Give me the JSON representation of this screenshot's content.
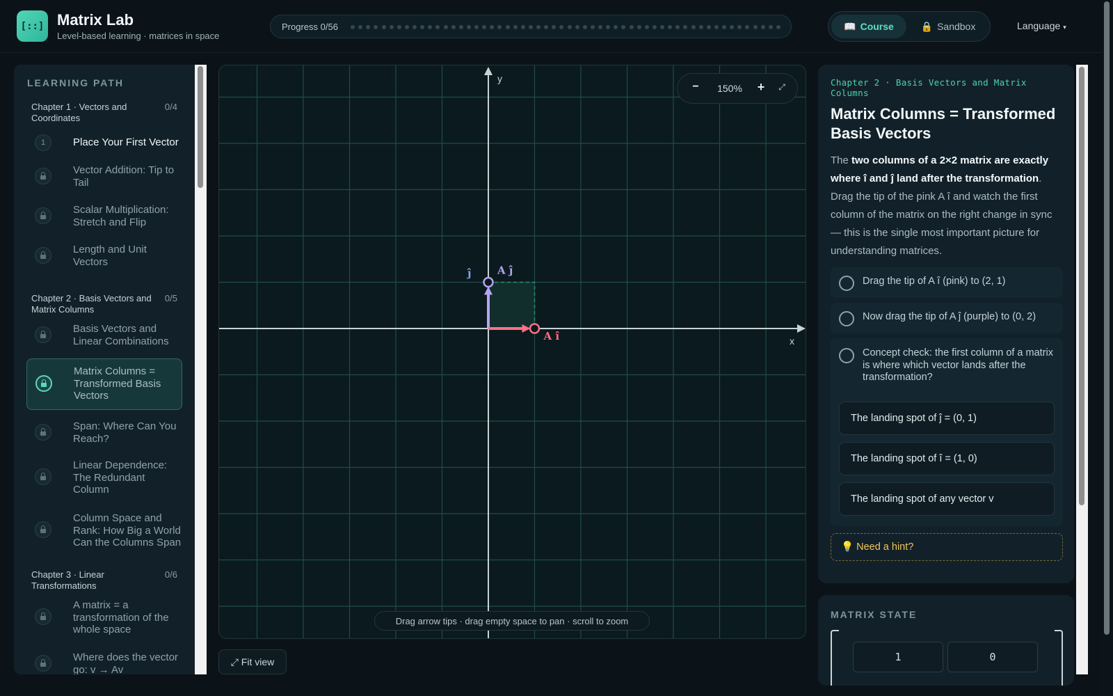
{
  "app": {
    "title": "Matrix Lab",
    "subtitle": "Level-based learning · matrices in space",
    "logo_text": "[::]"
  },
  "progress": {
    "label": "Progress 0/56",
    "completed": 0,
    "total": 56
  },
  "modes": {
    "course": {
      "icon": "📖",
      "label": "Course",
      "active": true
    },
    "sandbox": {
      "icon": "🔒",
      "label": "Sandbox",
      "active": false
    }
  },
  "language": {
    "label": "Language",
    "caret": "▾"
  },
  "sidebar": {
    "heading": "LEARNING PATH",
    "chapters": [
      {
        "name": "Chapter 1 · Vectors and Coordinates",
        "count": "0/4",
        "lessons": [
          {
            "label": "Place Your First Vector",
            "badge": "1",
            "locked": false,
            "active": false
          },
          {
            "label": "Vector Addition: Tip to Tail",
            "locked": true,
            "active": false
          },
          {
            "label": "Scalar Multiplication: Stretch and Flip",
            "locked": true,
            "active": false
          },
          {
            "label": "Length and Unit Vectors",
            "locked": true,
            "active": false
          }
        ]
      },
      {
        "name": "Chapter 2 · Basis Vectors and Matrix Columns",
        "count": "0/5",
        "lessons": [
          {
            "label": "Basis Vectors and Linear Combinations",
            "locked": true,
            "active": false
          },
          {
            "label": "Matrix Columns = Transformed Basis Vectors",
            "locked": true,
            "active": true
          },
          {
            "label": "Span: Where Can You Reach?",
            "locked": true,
            "active": false
          },
          {
            "label": "Linear Dependence: The Redundant Column",
            "locked": true,
            "active": false
          },
          {
            "label": "Column Space and Rank: How Big a World Can the Columns Span",
            "locked": true,
            "active": false
          }
        ]
      },
      {
        "name": "Chapter 3 · Linear Transformations",
        "count": "0/6",
        "lessons": [
          {
            "label": "A matrix = a transformation of the whole space",
            "locked": true,
            "active": false
          },
          {
            "label": "Where does the vector go: v → Av",
            "locked": true,
            "active": false
          }
        ]
      }
    ]
  },
  "canvas": {
    "zoom": {
      "minus": "−",
      "level": "150%",
      "plus": "+",
      "fullscreen": "⤢"
    },
    "axes": {
      "x_label": "x",
      "y_label": "y"
    },
    "vectors": {
      "ai": {
        "label": "A î",
        "x": 1,
        "y": 0,
        "color": "#ff6f86"
      },
      "aj": {
        "label": "A ĵ",
        "x": 0,
        "y": 1,
        "color": "#b7a3f2"
      },
      "j_label": "ĵ",
      "colors": {
        "grid": "#1f4d4a",
        "axis": "#c9d3d7",
        "parallelogram": "#2d8a72"
      }
    },
    "hint": "Drag arrow tips · drag empty space to pan · scroll to zoom",
    "fit_view": "⤢ Fit view"
  },
  "lesson": {
    "chapter": "Chapter 2 · Basis Vectors and Matrix Columns",
    "title": "Matrix Columns = Transformed Basis Vectors",
    "body": {
      "pre": "The ",
      "bold": "two columns of a 2×2 matrix are exactly where î and ĵ land after the transformation",
      "post": ". Drag the tip of the pink A î and watch the first column of the matrix on the right change in sync — this is the single most important picture for understanding matrices."
    },
    "tasks": [
      {
        "text": "Drag the tip of A î (pink) to (2, 1)"
      },
      {
        "text": "Now drag the tip of A ĵ (purple) to (0, 2)"
      },
      {
        "text": "Concept check: the first column of a matrix is where which vector lands after the transformation?"
      }
    ],
    "options": [
      {
        "text": "The landing spot of ĵ = (0, 1)"
      },
      {
        "text": "The landing spot of î = (1, 0)"
      },
      {
        "text": "The landing spot of any vector v"
      }
    ],
    "hint": {
      "icon": "💡",
      "label": "Need a hint?"
    }
  },
  "matrix_state": {
    "heading": "MATRIX STATE",
    "row1": [
      "1",
      "0"
    ]
  }
}
